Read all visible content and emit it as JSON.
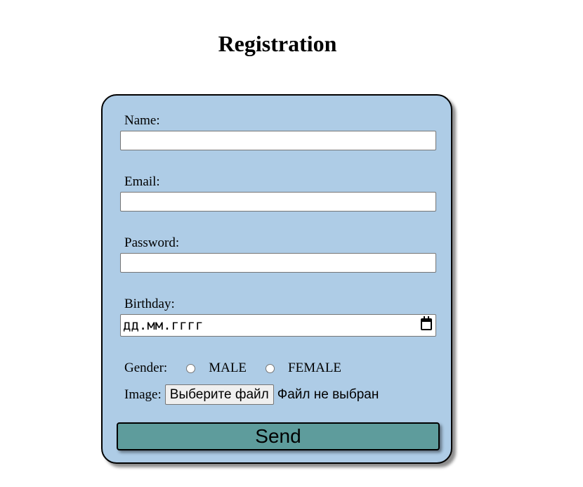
{
  "page": {
    "title": "Registration"
  },
  "form": {
    "name_label": "Name:",
    "name_value": "",
    "email_label": "Email:",
    "email_value": "",
    "password_label": "Password:",
    "password_value": "",
    "birthday_label": "Birthday:",
    "birthday_placeholder": "дд.мм.гггг",
    "gender_label": "Gender:",
    "gender_options": [
      "MALE",
      "FEMALE"
    ],
    "image_label": "Image:",
    "file_button_label": "Выберите файл",
    "file_status": "Файл не выбран",
    "send_label": "Send"
  },
  "colors": {
    "card_background": "#aecce6",
    "send_button": "#5e9c9c"
  },
  "icons": {
    "birthday_picker": "calendar-icon"
  }
}
